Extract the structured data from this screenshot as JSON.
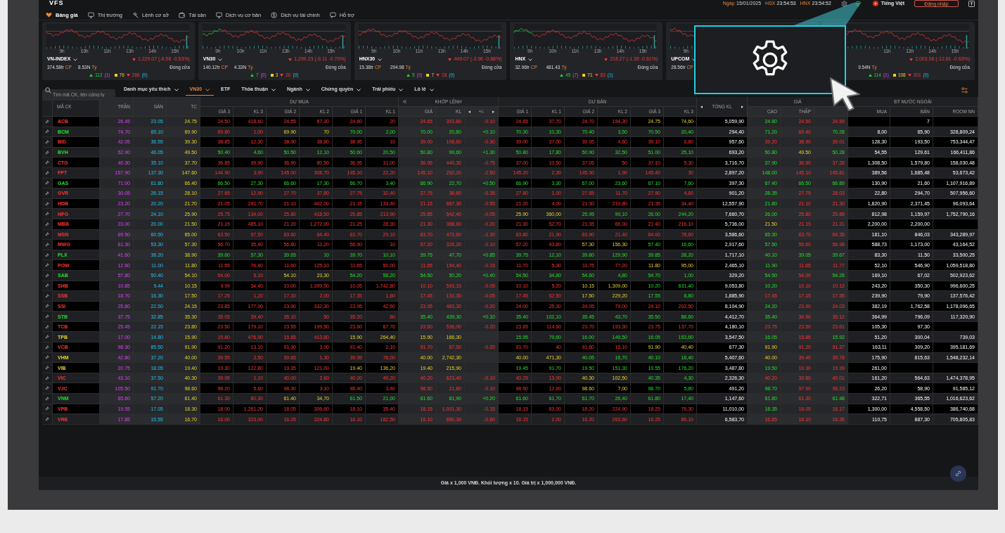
{
  "header": {
    "logo": "VFS",
    "nav": [
      {
        "label": "Bảng giá",
        "kind": "heart",
        "selected": true
      },
      {
        "label": "Thị trường",
        "kind": "monitor",
        "selected": false
      },
      {
        "label": "Lệnh cơ sở",
        "kind": "gavel",
        "selected": false
      },
      {
        "label": "Tài sản",
        "kind": "wallet",
        "selected": false
      },
      {
        "label": "Dịch vụ cơ bản",
        "kind": "monitor",
        "selected": false
      },
      {
        "label": "Dịch vụ tài chính",
        "kind": "coin",
        "selected": false
      },
      {
        "label": "Hỗ trợ",
        "kind": "chat",
        "selected": false
      }
    ],
    "date_label": "Ngày:",
    "date": "15/01/2025",
    "clocks": [
      {
        "exchange": "HSX",
        "time": "23:54:53"
      },
      {
        "exchange": "HNX",
        "time": "23:54:52"
      }
    ],
    "language": "Tiếng Việt",
    "login": "Đăng nhập"
  },
  "indices": [
    {
      "name": "VN-INDEX",
      "kind": "down",
      "value": "1,229.07 (-6.58 -0.53%)",
      "volume": "374.58tr",
      "volume_unit": "CP",
      "turnover": "8.53N",
      "turnover_unit": "Tỷ",
      "session": "Đóng cửa",
      "time_labels": [
        "9h",
        "10h",
        "11h",
        "13h",
        "14h",
        "15h"
      ],
      "breadth": {
        "up": "112",
        "ceiling": "(1)",
        "flat": "76",
        "down": "266",
        "floor": "(0)"
      }
    },
    {
      "name": "VN30",
      "kind": "down",
      "value": "1,299.23 (-9.11 -0.70%)",
      "volume": "140.12tr",
      "volume_unit": "CP",
      "turnover": "4.33N",
      "turnover_unit": "Tỷ",
      "session": "Đóng cửa",
      "time_labels": [
        "9h",
        "10h",
        "11h",
        "13h",
        "14h",
        "15h"
      ],
      "breadth": {
        "up": "7",
        "ceiling": "(0)",
        "flat": "3",
        "down": "20",
        "floor": "(0)"
      }
    },
    {
      "name": "HNX30",
      "kind": "down",
      "value": "449.07 (-3.96 -0.88%)",
      "volume": "15.38tr",
      "volume_unit": "CP",
      "turnover": "294.98",
      "turnover_unit": "Tỷ",
      "session": "Đóng cửa",
      "time_labels": [
        "9h",
        "10h",
        "11h",
        "13h",
        "14h",
        "15h"
      ],
      "breadth": {
        "up": "5",
        "ceiling": "(0)",
        "flat": "7",
        "down": "18",
        "floor": "(0)"
      }
    },
    {
      "name": "HNX",
      "kind": "down",
      "value": "218.27 (-1.35 -0.61%)",
      "volume": "32.96tr",
      "volume_unit": "CP",
      "turnover": "481.43",
      "turnover_unit": "Tỷ",
      "session": "Đóng cửa",
      "time_labels": [
        "9h",
        "10h",
        "11h",
        "13h",
        "14h",
        "15h"
      ],
      "breadth": {
        "up": "45",
        "ceiling": "(7)",
        "flat": "71",
        "down": "83",
        "floor": "(1)"
      }
    },
    {
      "name": "UPCOM",
      "volume": "28.56tr",
      "volume_unit": "CP",
      "time_labels": [
        "9h"
      ]
    },
    {
      "kind": "down",
      "value": "2,003.06 (-12.81 -0.63%)",
      "turnover": "9.54N",
      "turnover_unit": "Tỷ",
      "session": "Đóng cửa",
      "time_labels": [
        "11h",
        "13h",
        "14h",
        "15h"
      ],
      "breadth": {
        "up": "114",
        "ceiling": "(1)",
        "flat": "108",
        "down": "201",
        "floor": "(0)"
      }
    }
  ],
  "toolbar": {
    "search": {
      "placeholder": "Tìm mã CK, tên công ty"
    },
    "tabs": [
      {
        "label": "Danh mục yêu thích",
        "dropdown": true,
        "selected": false
      },
      {
        "label": "VN30",
        "dropdown": true,
        "selected": true
      },
      {
        "label": "ETF",
        "dropdown": false,
        "selected": false
      },
      {
        "label": "Thỏa thuận",
        "dropdown": true,
        "selected": false
      },
      {
        "label": "Ngành",
        "dropdown": true,
        "selected": false
      },
      {
        "label": "Chứng quyền",
        "dropdown": true,
        "selected": false
      },
      {
        "label": "Trái phiếu",
        "dropdown": true,
        "selected": false
      },
      {
        "label": "Lô lẻ",
        "dropdown": true,
        "selected": false
      }
    ]
  },
  "table": {
    "groups": [
      {
        "kind": "single",
        "columns": [
          {
            "label": "MÃ CK",
            "kind": "symbol",
            "shaded": false
          }
        ]
      },
      {
        "kind": "single",
        "columns": [
          {
            "label": "TRẦN",
            "kind": "ceiling",
            "shaded": true
          }
        ]
      },
      {
        "kind": "single",
        "columns": [
          {
            "label": "SÀN",
            "kind": "floor",
            "shaded": true
          }
        ]
      },
      {
        "kind": "single",
        "columns": [
          {
            "label": "TC",
            "kind": "reference",
            "shaded": true
          }
        ]
      },
      {
        "kind": "book",
        "label": "DƯ MUA",
        "columns": [
          {
            "label": "GIÁ 3",
            "kind": "price",
            "shaded": false
          },
          {
            "label": "KL 3",
            "kind": "volume",
            "shaded": false
          },
          {
            "label": "GIÁ 2",
            "kind": "price",
            "shaded": false
          },
          {
            "label": "KL 2",
            "kind": "volume",
            "shaded": false
          },
          {
            "label": "GIÁ 1",
            "kind": "price",
            "shaded": false
          },
          {
            "label": "KL 1",
            "kind": "volume",
            "shaded": false
          }
        ]
      },
      {
        "kind": "match",
        "label": "KHỚP LỆNH",
        "columns": [
          {
            "label": "GIÁ",
            "kind": "price",
            "shaded": true
          },
          {
            "label": "KL",
            "kind": "volume",
            "shaded": true
          },
          {
            "label": "+/-",
            "kind": "change",
            "shaded": true
          }
        ]
      },
      {
        "kind": "book",
        "label": "DƯ BÁN",
        "columns": [
          {
            "label": "GIÁ 1",
            "kind": "price",
            "shaded": false
          },
          {
            "label": "KL 1",
            "kind": "volume",
            "shaded": false
          },
          {
            "label": "GIÁ 2",
            "kind": "price",
            "shaded": false
          },
          {
            "label": "KL 2",
            "kind": "volume",
            "shaded": false
          },
          {
            "label": "GIÁ 3",
            "kind": "price",
            "shaded": false
          },
          {
            "label": "KL 3",
            "kind": "volume",
            "shaded": false
          }
        ]
      },
      {
        "kind": "single",
        "columns": [
          {
            "label": "TỔNG KL",
            "kind": "total",
            "shaded": false
          }
        ]
      },
      {
        "kind": "book",
        "label": "GIÁ",
        "columns": [
          {
            "label": "CAO",
            "kind": "price",
            "shaded": true
          },
          {
            "label": "THẤP",
            "kind": "price",
            "shaded": true
          },
          {
            "kind": "price",
            "shaded": true
          }
        ]
      },
      {
        "kind": "book",
        "label": "ĐT NƯỚC NGOÀI",
        "columns": [
          {
            "label": "MUA",
            "kind": "plain",
            "shaded": false
          },
          {
            "label": "BÁN",
            "kind": "plain",
            "shaded": false
          },
          {
            "label": "ROOM NN",
            "kind": "plain",
            "shaded": false
          }
        ]
      }
    ],
    "rows": [
      {
        "symbol": "ACB",
        "cells": [
          "26.45",
          "23.05",
          "24.75",
          "24.50",
          "418,60",
          "24.55",
          "87,30",
          "24.60",
          "20",
          "24.65",
          "393,80",
          "-0.10",
          "24.65",
          "37,70",
          "24.70",
          "194,30",
          "24.75",
          "74,60",
          "5,059,90",
          "24.80",
          "24.50",
          "24.59",
          null,
          "7",
          null
        ]
      },
      {
        "symbol": "BCM",
        "cells": [
          "74.70",
          "65.10",
          "69.90",
          "69.80",
          "1,00",
          "69.90",
          "70",
          "70.00",
          "2,00",
          "70.00",
          "20,80",
          "+0.10",
          "70.30",
          "10,30",
          "70.40",
          "3,50",
          "70.50",
          "20,40",
          "294,40",
          "71.20",
          "69.40",
          "70.28",
          "8,00",
          "65,90",
          "328,809,24"
        ]
      },
      {
        "symbol": "BID",
        "cells": [
          "42.05",
          "36.55",
          "39.30",
          "38.85",
          "12,30",
          "38.90",
          "38,80",
          "38.95",
          "10",
          "39.00",
          "108,60",
          "-0.30",
          "39.00",
          "37,00",
          "39.05",
          "4,60",
          "39.10",
          "6,80",
          "957,60",
          "39.20",
          "38.90",
          "39.01",
          "128,30",
          "193,50",
          "753,344,47"
        ]
      },
      {
        "symbol": "BVH",
        "cells": [
          "52.90",
          "46.05",
          "49.50",
          "50.40",
          "4,60",
          "50.50",
          "12,10",
          "50.60",
          "20,50",
          "50.80",
          "99,60",
          "+1.30",
          "50.80",
          "17,80",
          "50.90",
          "32,50",
          "51.00",
          "25,10",
          "693,20",
          "50.80",
          "49.50",
          "50.28",
          "54,55",
          "129,61",
          "166,411,86"
        ]
      },
      {
        "symbol": "CTG",
        "cells": [
          "40.30",
          "35.10",
          "37.70",
          "36.85",
          "39,90",
          "36.90",
          "80,50",
          "36.95",
          "31,00",
          "36.95",
          "440,30",
          "-0.75",
          "37.00",
          "10,50",
          "37.05",
          "50",
          "37.10",
          "5,30",
          "3,716,70",
          "37.90",
          "36.90",
          "37.26",
          "1,308,50",
          "1,579,80",
          "158,030,48"
        ]
      },
      {
        "symbol": "FPT",
        "cells": [
          "157.90",
          "137.30",
          "147.60",
          "144.90",
          "3,90",
          "145.00",
          "308,70",
          "145.10",
          "22,20",
          "145.10",
          "292,20",
          "-2.50",
          "145.20",
          "2,30",
          "145.30",
          "1,90",
          "145.40",
          "30",
          "2,897,20",
          "148.00",
          "145.10",
          "145.81",
          "389,56",
          "1,685,48",
          "53,673,42"
        ]
      },
      {
        "symbol": "GAS",
        "cells": [
          "71.00",
          "61.80",
          "66.40",
          "66.50",
          "27,30",
          "66.60",
          "17,30",
          "66.70",
          "3,40",
          "66.90",
          "22,70",
          "+0.50",
          "66.90",
          "3,30",
          "67.00",
          "23,60",
          "67.10",
          "7,60",
          "397,30",
          "67.40",
          "66.50",
          "66.89",
          "130,90",
          "21,60",
          "1,107,916,89"
        ]
      },
      {
        "symbol": "GVR",
        "cells": [
          "30.05",
          "26.15",
          "28.10",
          "27.65",
          "12,90",
          "27.70",
          "37,80",
          "27.75",
          "32,40",
          "27.75",
          "38,60",
          "-0.35",
          "27.80",
          "1,00",
          "27.85",
          "11,70",
          "27.90",
          "4,60",
          "901,20",
          "28.35",
          "27.75",
          "28.03",
          "22,80",
          "294,70",
          "507,956,60"
        ]
      },
      {
        "symbol": "HDB",
        "cells": [
          "23.20",
          "20.20",
          "21.70",
          "21.05",
          "241,70",
          "21.10",
          "402,00",
          "21.15",
          "133,40",
          "21.15",
          "887,30",
          "-0.55",
          "21.20",
          "4,00",
          "21.30",
          "219,80",
          "21.35",
          "34,40",
          "12,557,90",
          "21.80",
          "21.10",
          "21.30",
          "1,820,90",
          "2,371,45",
          "96,093,64"
        ]
      },
      {
        "symbol": "HPG",
        "cells": [
          "27.70",
          "24.10",
          "25.90",
          "25.75",
          "134,00",
          "25.80",
          "418,50",
          "25.85",
          "213,90",
          "25.85",
          "542,40",
          "-0.05",
          "25.90",
          "360,00",
          "25.95",
          "99,10",
          "26.00",
          "244,20",
          "7,660,70",
          "26.00",
          "25.80",
          "25.88",
          "812,98",
          "1,159,97",
          "1,752,790,16"
        ]
      },
      {
        "symbol": "MBB",
        "cells": [
          "23.00",
          "20.00",
          "21.50",
          "21.15",
          "485,10",
          "21.20",
          "1,272,00",
          "21.25",
          "28,30",
          "21.30",
          "368,60",
          "-0.20",
          "21.30",
          "52,70",
          "21.35",
          "66,00",
          "21.40",
          "216,10",
          "5,736,00",
          "21.50",
          "21.15",
          "21.31",
          "2,200,00",
          "2,200,00",
          null
        ]
      },
      {
        "symbol": "MSN",
        "cells": [
          "69.50",
          "60.50",
          "65.00",
          "63.50",
          "97,50",
          "63.60",
          "64,40",
          "63.70",
          "29,10",
          "63.70",
          "472,60",
          "-1.30",
          "63.80",
          "21,90",
          "63.90",
          "21,40",
          "64.00",
          "78,60",
          "3,586,60",
          "65.30",
          "63.70",
          "64.35",
          "181,10",
          "846,03",
          "343,289,97"
        ]
      },
      {
        "symbol": "MWG",
        "cells": [
          "61.30",
          "53.30",
          "57.30",
          "56.70",
          "35,40",
          "56.80",
          "11,20",
          "56.90",
          "10",
          "57.20",
          "326,20",
          "-0.10",
          "57.20",
          "43,80",
          "57.30",
          "156,30",
          "57.40",
          "16,60",
          "2,917,60",
          "57.50",
          "56.60",
          "56.98",
          "588,73",
          "1,173,00",
          "43,164,52"
        ]
      },
      {
        "symbol": "PLX",
        "cells": [
          "41.60",
          "36.20",
          "38.90",
          "39.60",
          "57,30",
          "39.65",
          "10",
          "39.70",
          "10,10",
          "39.75",
          "47,70",
          "+0.85",
          "39.75",
          "12,10",
          "39.80",
          "129,90",
          "39.85",
          "28,20",
          "1,717,10",
          "40.10",
          "39.05",
          "39.67",
          "83,30",
          "11,50",
          "33,500,25"
        ]
      },
      {
        "symbol": "POW",
        "cells": [
          "12.60",
          "11.00",
          "11.80",
          "11.55",
          "76,40",
          "11.60",
          "125,10",
          "11.65",
          "50,00",
          "11.65",
          "154,40",
          "-0.15",
          "11.70",
          "5,30",
          "11.75",
          "77,20",
          "11.80",
          "95,00",
          "2,465,10",
          "11.90",
          "11.65",
          "11.77",
          "52,10",
          "546,90",
          "1,059,518,80"
        ]
      },
      {
        "symbol": "SAB",
        "cells": [
          "57.80",
          "50.40",
          "54.10",
          "54.00",
          "6,10",
          "54.10",
          "23,30",
          "54.20",
          "58,20",
          "54.50",
          "50,20",
          "+0.40",
          "54.50",
          "34,80",
          "54.60",
          "4,80",
          "54.70",
          "1,00",
          "329,20",
          "54.50",
          "54.00",
          "54.26",
          "169,10",
          "67,02",
          "502,923,62"
        ]
      },
      {
        "symbol": "SHB",
        "cells": [
          "10.85",
          "9.44",
          "10.15",
          "9.99",
          "34,40",
          "10.00",
          "1,399,50",
          "10.05",
          "1,742,80",
          "10.10",
          "593,10",
          "-0.05",
          "10.10",
          "5,20",
          "10.15",
          "1,309,00",
          "10.20",
          "631,40",
          "9,053,80",
          "10.20",
          "10.10",
          "10.12",
          "243,20",
          "350,30",
          "996,600,25"
        ]
      },
      {
        "symbol": "SSB",
        "cells": [
          "18.70",
          "16.30",
          "17.50",
          "17.25",
          "1,20",
          "17.30",
          "2,00",
          "17.35",
          "1,60",
          "17.45",
          "131,30",
          "-0.05",
          "17.45",
          "52,50",
          "17.50",
          "229,20",
          "17.55",
          "6,80",
          "1,885,90",
          "17.45",
          "17.15",
          "17.35",
          "239,90",
          "79,90",
          "137,576,42"
        ]
      },
      {
        "symbol": "SSI",
        "cells": [
          "25.80",
          "22.50",
          "24.15",
          "23.85",
          "177,90",
          "23.90",
          "332,30",
          "23.95",
          "42,60",
          "23.95",
          "463,30",
          "-0.20",
          "24.00",
          "25,30",
          "24.05",
          "79,00",
          "24.10",
          "203,50",
          "8,104,90",
          "24.20",
          "23.90",
          "24.03",
          "382,19",
          "1,762,58",
          "1,178,096,65"
        ]
      },
      {
        "symbol": "STB",
        "cells": [
          "37.75",
          "32.85",
          "35.30",
          "35.05",
          "39,40",
          "35.10",
          "50",
          "35.20",
          "60",
          "35.40",
          "439,30",
          "+0.10",
          "35.40",
          "102,10",
          "35.45",
          "43,70",
          "35.50",
          "88,60",
          "4,412,70",
          "35.40",
          "34.90",
          "35.12",
          "364,99",
          "796,09",
          "117,320,90"
        ]
      },
      {
        "symbol": "TCB",
        "cells": [
          "25.45",
          "22.15",
          "23.80",
          "23.50",
          "179,10",
          "23.55",
          "199,50",
          "23.60",
          "87,70",
          "23.60",
          "536,00",
          "-0.20",
          "23.65",
          "114,60",
          "23.70",
          "193,30",
          "23.75",
          "137,70",
          "4,180,10",
          "23.75",
          "23.50",
          "23.61",
          "105,30",
          "97,30",
          null
        ]
      },
      {
        "symbol": "TPB",
        "cells": [
          "17.00",
          "14.80",
          "15.90",
          "15.80",
          "476,90",
          "15.85",
          "413,80",
          "15.90",
          "264,40",
          "15.90",
          "166,30",
          null,
          "15.95",
          "79,60",
          "16.00",
          "149,50",
          "16.05",
          "153,60",
          "3,547,50",
          "16.05",
          "15.85",
          "15.92",
          "51,20",
          "300,04",
          "739,03"
        ]
      },
      {
        "symbol": "VCB",
        "cells": [
          "98.30",
          "85.50",
          "91.90",
          "91.20",
          "13,10",
          "91.30",
          "3,00",
          "91.40",
          "2,10",
          "91.70",
          "67,50",
          "-0.20",
          "91.70",
          "40",
          "91.80",
          "15,10",
          "91.90",
          "40,40",
          "677,30",
          "91.90",
          "91.20",
          "91.37",
          "163,11",
          "309,20",
          "395,181,69"
        ]
      },
      {
        "symbol": "VHM",
        "cells": [
          "42.80",
          "37.20",
          "40.00",
          "39.55",
          "2,50",
          "39.65",
          "1,30",
          "39.95",
          "78,00",
          "40.00",
          "2,742,30",
          null,
          "40.00",
          "471,30",
          "40.05",
          "16,70",
          "40.10",
          "18,40",
          "5,407,60",
          "40.00",
          "39.40",
          "39.78",
          "175,90",
          "815,63",
          "1,548,232,14"
        ]
      },
      {
        "symbol": "VIB",
        "cells": [
          "20.75",
          "18.05",
          "19.40",
          "19.30",
          "122,80",
          "19.35",
          "121,00",
          "19.40",
          "136,20",
          "19.40",
          "215,90",
          null,
          "19.45",
          "91,70",
          "19.50",
          "151,30",
          "19.55",
          "176,20",
          "3,487,80",
          "19.50",
          "19.30",
          "19.39",
          "261,00",
          null,
          null
        ]
      },
      {
        "symbol": "VIC",
        "cells": [
          "43.10",
          "37.50",
          "40.30",
          "39.95",
          "1,10",
          "40.00",
          "2,60",
          "40.20",
          "49,20",
          "40.20",
          "623,40",
          "-0.10",
          "40.25",
          "13,90",
          "40.30",
          "102,50",
          "40.35",
          "4,30",
          "2,326,30",
          "40.20",
          "39.80",
          "40.01",
          "161,20",
          "564,63",
          "1,474,378,95"
        ]
      },
      {
        "symbol": "VJC",
        "cells": [
          "105.50",
          "91.70",
          "98.60",
          "98.20",
          "5,60",
          "98.30",
          "3,10",
          "98.40",
          "3,40",
          "98.50",
          "21,80",
          "-0.10",
          "98.50",
          "12,60",
          "98.60",
          "7,00",
          "98.70",
          "5,80",
          "491,20",
          "98.70",
          "97.90",
          "98.23",
          "26,20",
          "58,90",
          "91,585,12"
        ]
      },
      {
        "symbol": "VNM",
        "cells": [
          "65.60",
          "57.20",
          "61.40",
          "61.30",
          "80,30",
          "61.40",
          "34,70",
          "61.50",
          "21,00",
          "61.60",
          "81,90",
          "+0.20",
          "61.60",
          "61,70",
          "61.70",
          "26,40",
          "61.80",
          "17,40",
          "1,147,60",
          "61.80",
          "61.30",
          "61.48",
          "322,71",
          "365,55",
          "1,016,623,62"
        ]
      },
      {
        "symbol": "VPB",
        "cells": [
          "19.55",
          "17.05",
          "18.30",
          "18.00",
          "1,261,20",
          "18.05",
          "306,60",
          "18.10",
          "35,40",
          "18.15",
          "1,001,30",
          "-0.15",
          "18.15",
          "63,00",
          "18.20",
          "224,90",
          "18.25",
          "76,30",
          "11,010,00",
          "18.35",
          "18.05",
          "18.17",
          "1,300,00",
          "4,558,50",
          "386,740,68"
        ]
      },
      {
        "symbol": "VRE",
        "cells": [
          "17.85",
          "15.55",
          "16.70",
          "16.00",
          "323,00",
          "16.05",
          "324,80",
          "16.10",
          "182,50",
          "16.10",
          "880,30",
          "-0.60",
          "16.15",
          "2,00",
          "16.20",
          "263,60",
          "16.25",
          "86,10",
          "6,583,70",
          "16.65",
          "16.10",
          "16.35",
          "110,75",
          "887,30",
          "705,805,83"
        ]
      }
    ]
  },
  "footer": "Giá x 1,000 VNĐ. Khối lượng x 10. Giá trị x 1,000,000 VNĐ."
}
